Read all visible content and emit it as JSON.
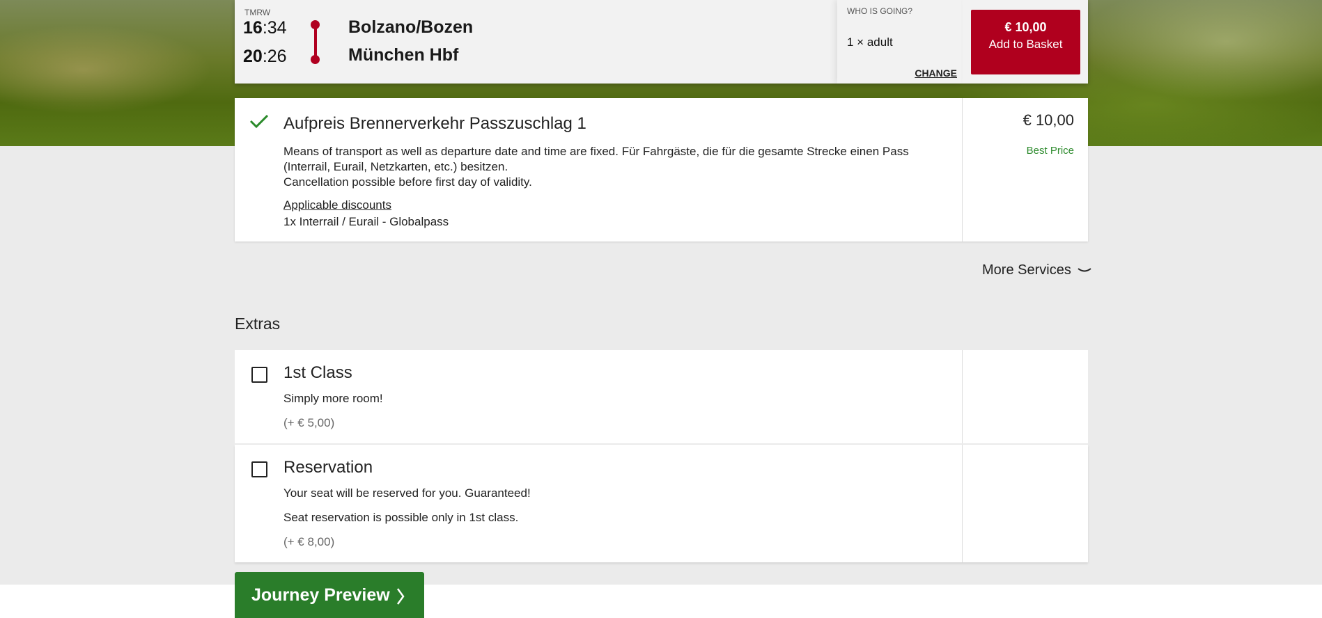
{
  "header": {
    "day_label": "TMRW",
    "departure": {
      "hour": "16",
      "minute": ":34",
      "station": "Bolzano/Bozen"
    },
    "arrival": {
      "hour": "20",
      "minute": ":26",
      "station": "München Hbf"
    },
    "who_label": "WHO IS GOING?",
    "passengers": "1 × adult",
    "change_label": "CHANGE",
    "basket_price": "€ 10,00",
    "basket_label": "Add to Basket",
    "accent_color": "#b0001e"
  },
  "offer": {
    "title": "Aufpreis Brennerverkehr Passzuschlag 1",
    "description_1": "Means of transport as well as departure date and time are fixed. Für Fahrgäste, die für die gesamte Strecke einen Pass (Interrail, Eurail, Netzkarten, etc.) besitzen.",
    "description_2": "Cancellation possible before first day of validity.",
    "discounts_link": "Applicable discounts",
    "discount_item": "1x Interrail / Eurail - Globalpass",
    "price": "€ 10,00",
    "price_tag": "Best Price",
    "selected_icon": "checkmark-icon"
  },
  "more_services_label": "More Services",
  "extras": {
    "title": "Extras",
    "items": [
      {
        "title": "1st Class",
        "lines": [
          "Simply more room!"
        ],
        "price": "(+ € 5,00)"
      },
      {
        "title": "Reservation",
        "lines": [
          "Your seat will be reserved for you. Guaranteed!",
          "Seat reservation is possible only in 1st class."
        ],
        "price": "(+ € 8,00)"
      }
    ]
  },
  "journey_preview_label": "Journey Preview",
  "brand_green": "#2a7d2a"
}
